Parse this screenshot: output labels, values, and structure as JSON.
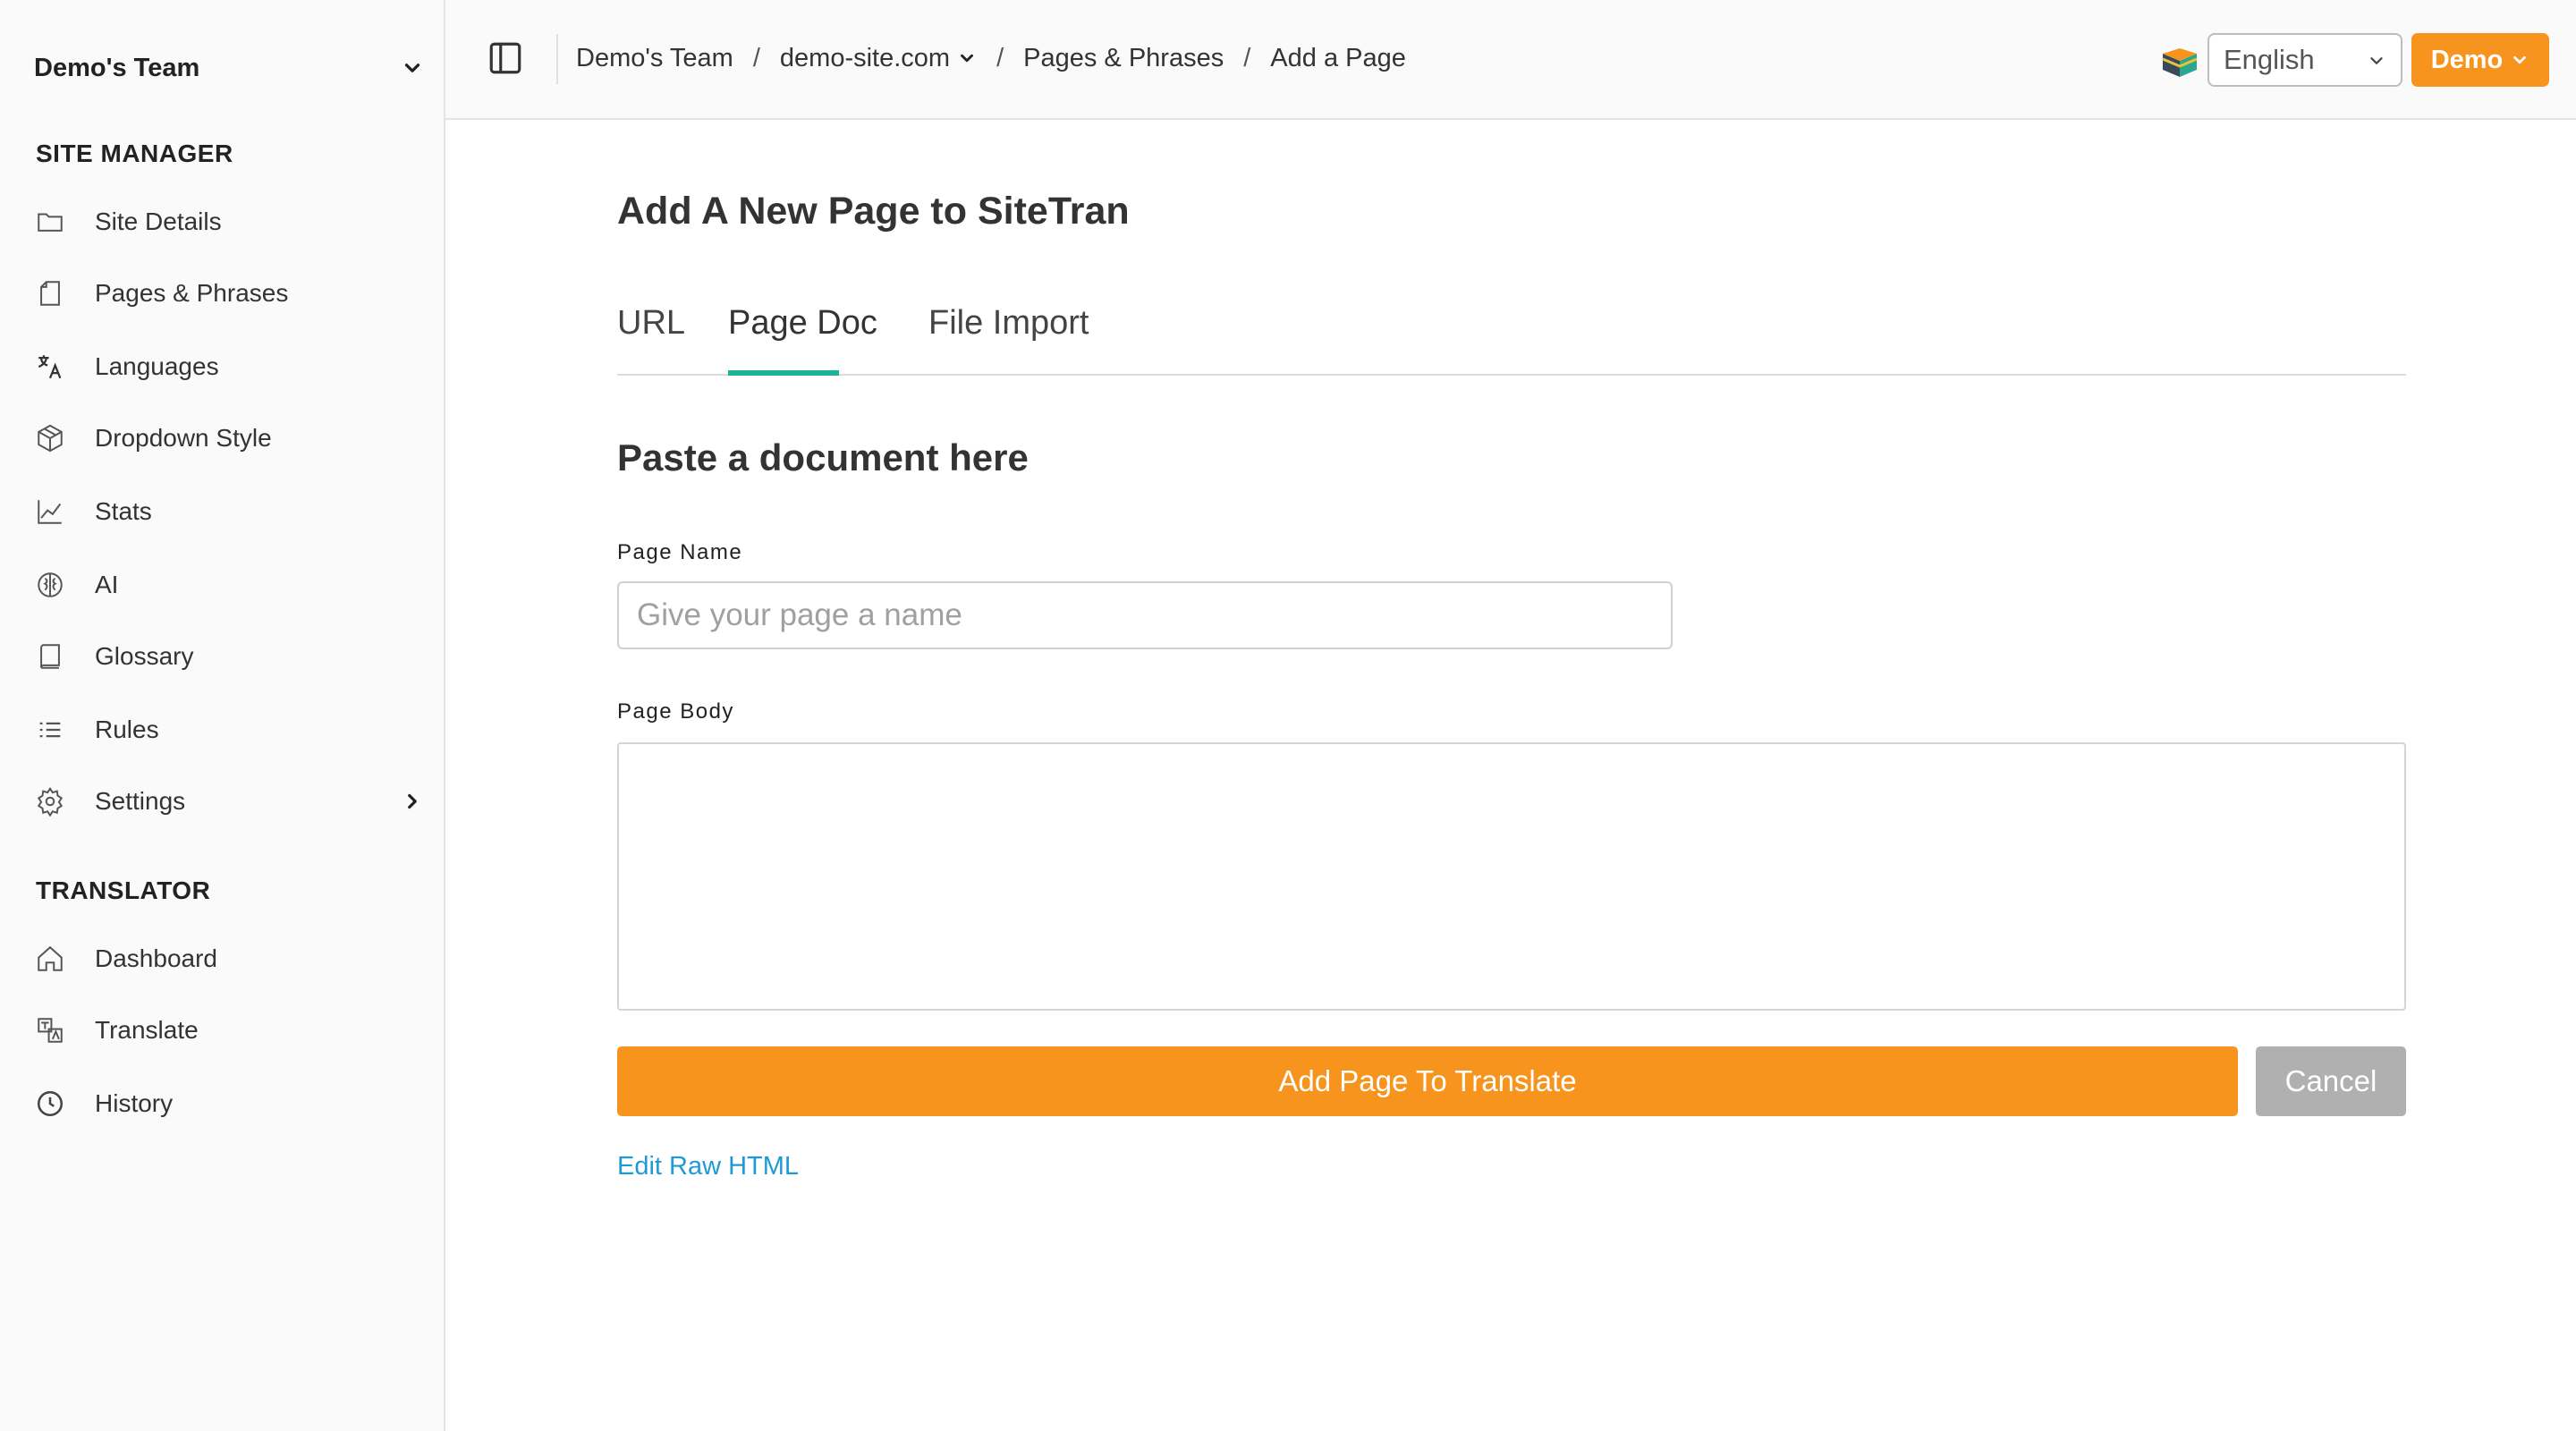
{
  "sidebar": {
    "team_name": "Demo's Team",
    "site_manager_title": "SITE MANAGER",
    "site_manager_items": [
      {
        "label": "Site Details",
        "icon": "folder-icon"
      },
      {
        "label": "Pages & Phrases",
        "icon": "page-icon"
      },
      {
        "label": "Languages",
        "icon": "translate-icon"
      },
      {
        "label": "Dropdown Style",
        "icon": "box-icon"
      },
      {
        "label": "Stats",
        "icon": "chart-line-icon"
      },
      {
        "label": "AI",
        "icon": "brain-icon"
      },
      {
        "label": "Glossary",
        "icon": "book-icon"
      },
      {
        "label": "Rules",
        "icon": "list-icon"
      },
      {
        "label": "Settings",
        "icon": "gear-icon"
      }
    ],
    "translator_title": "TRANSLATOR",
    "translator_items": [
      {
        "label": "Dashboard",
        "icon": "home-icon"
      },
      {
        "label": "Translate",
        "icon": "translate-doc-icon"
      },
      {
        "label": "History",
        "icon": "clock-icon"
      }
    ]
  },
  "header": {
    "breadcrumb": {
      "team": "Demo's Team",
      "site": "demo-site.com",
      "section": "Pages & Phrases",
      "current": "Add a Page",
      "separator": "/"
    },
    "language_select": "English",
    "user_button": "Demo"
  },
  "main": {
    "title": "Add A New Page to SiteTran",
    "tabs": [
      {
        "label": "URL"
      },
      {
        "label": "Page Doc"
      },
      {
        "label": "File Import"
      }
    ],
    "active_tab": "Page Doc",
    "section_heading": "Paste a document here",
    "page_name_label": "Page Name",
    "page_name_placeholder": "Give your page a name",
    "page_name_value": "",
    "page_body_label": "Page Body",
    "page_body_value": "",
    "submit_label": "Add Page To Translate",
    "cancel_label": "Cancel",
    "raw_html_link": "Edit Raw HTML"
  },
  "colors": {
    "accent": "#f7941d",
    "tab_underline": "#1db39a",
    "link": "#1e9ad6",
    "cancel": "#b0b0b0"
  }
}
